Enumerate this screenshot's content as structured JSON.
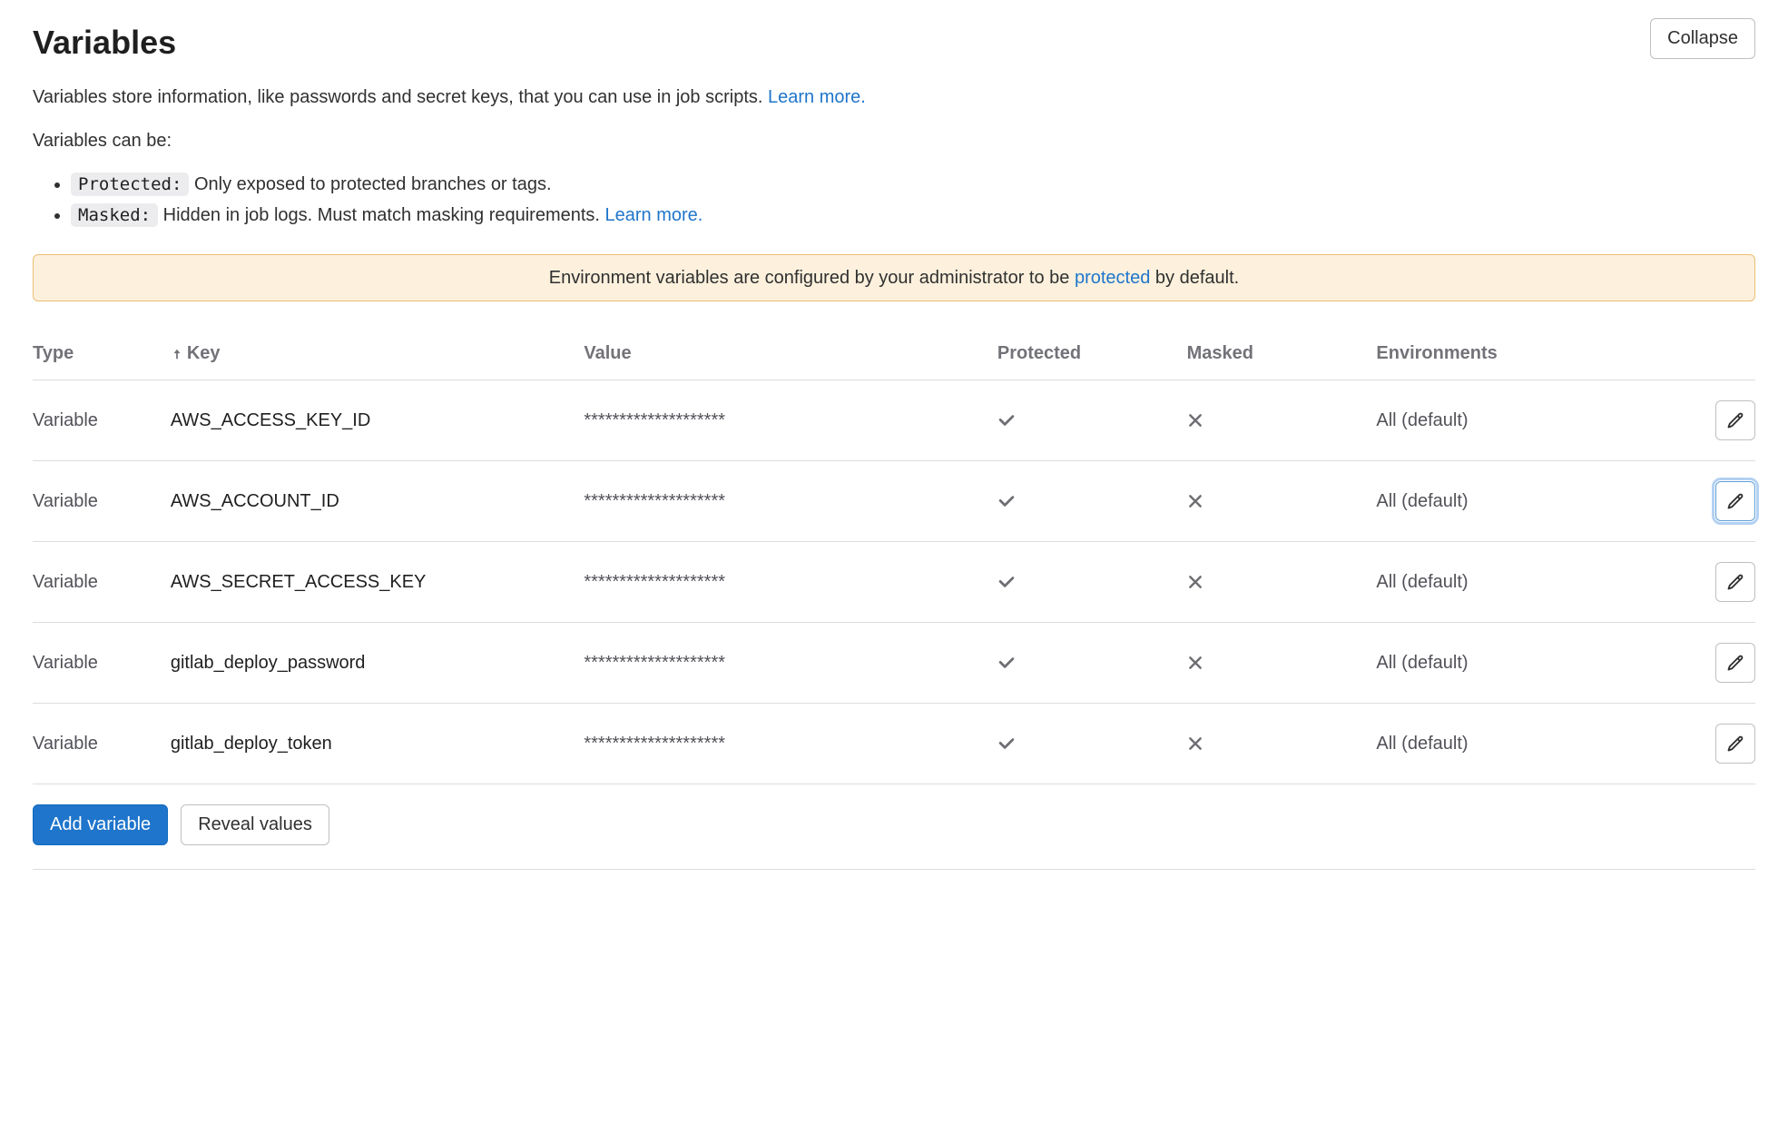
{
  "header": {
    "title": "Variables",
    "collapse_label": "Collapse"
  },
  "description": {
    "intro_prefix": "Variables store information, like passwords and secret keys, that you can use in job scripts. ",
    "learn_more": "Learn more.",
    "can_be": "Variables can be:",
    "protected_code": "Protected:",
    "protected_text": " Only exposed to protected branches or tags.",
    "masked_code": "Masked:",
    "masked_text_prefix": " Hidden in job logs. Must match masking requirements. ",
    "masked_learn_more": "Learn more."
  },
  "alert": {
    "prefix": "Environment variables are configured by your administrator to be ",
    "link": "protected",
    "suffix": " by default."
  },
  "table": {
    "headers": {
      "type": "Type",
      "key": "Key",
      "value": "Value",
      "protected": "Protected",
      "masked": "Masked",
      "environments": "Environments"
    },
    "rows": [
      {
        "type": "Variable",
        "key": "AWS_ACCESS_KEY_ID",
        "value": "********************",
        "protected": true,
        "masked": false,
        "env": "All (default)",
        "focused": false
      },
      {
        "type": "Variable",
        "key": "AWS_ACCOUNT_ID",
        "value": "********************",
        "protected": true,
        "masked": false,
        "env": "All (default)",
        "focused": true
      },
      {
        "type": "Variable",
        "key": "AWS_SECRET_ACCESS_KEY",
        "value": "********************",
        "protected": true,
        "masked": false,
        "env": "All (default)",
        "focused": false
      },
      {
        "type": "Variable",
        "key": "gitlab_deploy_password",
        "value": "********************",
        "protected": true,
        "masked": false,
        "env": "All (default)",
        "focused": false
      },
      {
        "type": "Variable",
        "key": "gitlab_deploy_token",
        "value": "********************",
        "protected": true,
        "masked": false,
        "env": "All (default)",
        "focused": false
      }
    ]
  },
  "footer": {
    "add_variable": "Add variable",
    "reveal_values": "Reveal values"
  }
}
